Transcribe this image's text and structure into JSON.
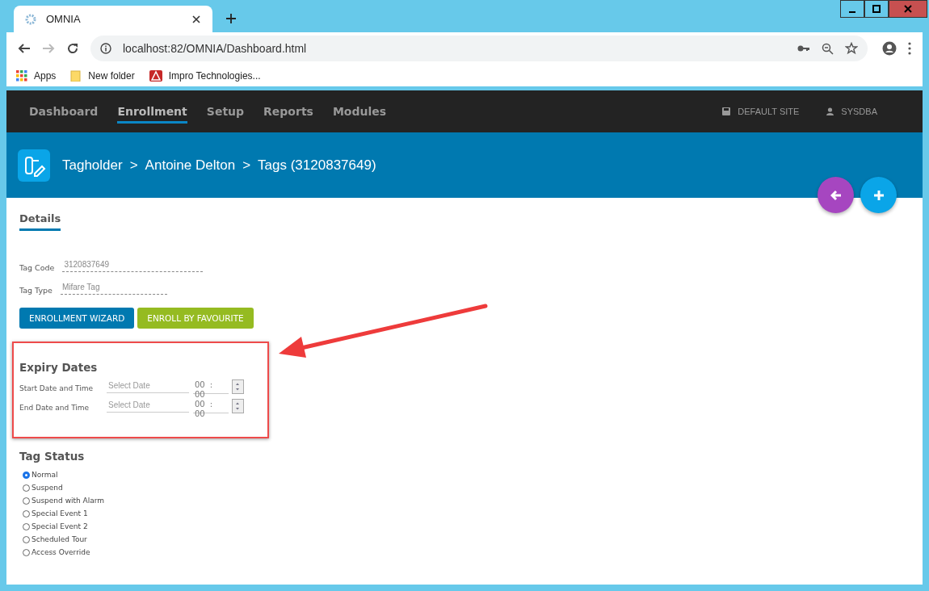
{
  "browser": {
    "tab_title": "OMNIA",
    "url": "localhost:82/OMNIA/Dashboard.html",
    "bookmarks": [
      {
        "label": "Apps",
        "kind": "apps"
      },
      {
        "label": "New folder",
        "kind": "folder"
      },
      {
        "label": "Impro Technologies...",
        "kind": "site"
      }
    ]
  },
  "nav": {
    "items": [
      {
        "label": "Dashboard",
        "selected": false
      },
      {
        "label": "Enrollment",
        "selected": true
      },
      {
        "label": "Setup",
        "selected": false
      },
      {
        "label": "Reports",
        "selected": false
      },
      {
        "label": "Modules",
        "selected": false
      }
    ],
    "site": "DEFAULT SITE",
    "user": "SYSDBA"
  },
  "header": {
    "breadcrumb": [
      "Tagholder",
      ">",
      "Antoine Delton",
      ">",
      "Tags (3120837649)"
    ]
  },
  "tabs": [
    {
      "label": "Details",
      "selected": true
    }
  ],
  "fields": [
    {
      "label": "Tag Code",
      "value": "3120837649"
    },
    {
      "label": "Tag Type",
      "value": "Mifare Tag"
    }
  ],
  "buttons": [
    {
      "label": "ENROLLMENT WIZARD",
      "kind": "primary"
    },
    {
      "label": "ENROLL BY FAVOURITE",
      "kind": "secondary"
    }
  ],
  "expiry": {
    "title": "Expiry Dates",
    "rows": [
      {
        "label": "Start Date and Time",
        "placeholder": "Select Date",
        "hours": "00",
        "separator": ":",
        "minutes": "00"
      },
      {
        "label": "End Date and Time",
        "placeholder": "Select Date",
        "hours": "00",
        "separator": ":",
        "minutes": "00"
      }
    ]
  },
  "status": {
    "title": "Tag Status",
    "options": [
      {
        "label": "Normal",
        "selected": true
      },
      {
        "label": "Suspend",
        "selected": false
      },
      {
        "label": "Suspend with Alarm",
        "selected": false
      },
      {
        "label": "Special Event 1",
        "selected": false
      },
      {
        "label": "Special Event 2",
        "selected": false
      },
      {
        "label": "Scheduled Tour",
        "selected": false
      },
      {
        "label": "Access Override",
        "selected": false
      }
    ]
  }
}
